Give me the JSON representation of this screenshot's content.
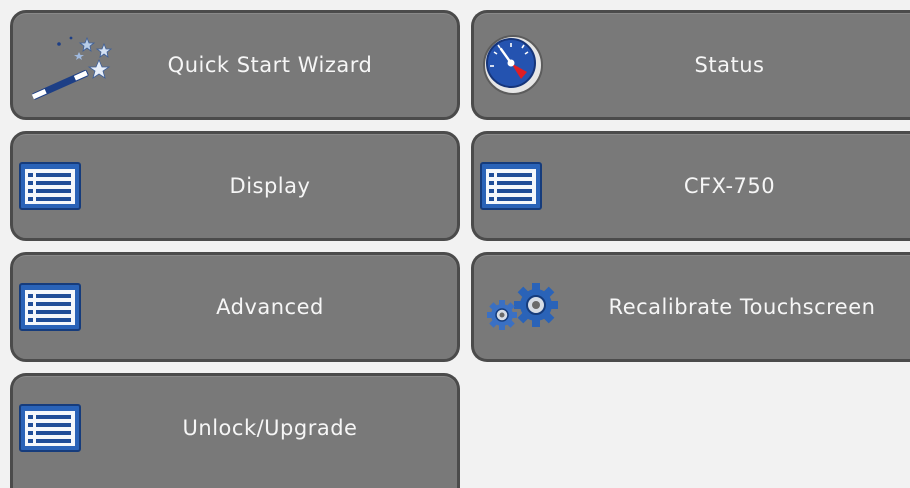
{
  "menu": {
    "items": [
      {
        "label": "Quick Start Wizard",
        "icon": "magic-wand-icon"
      },
      {
        "label": "Status",
        "icon": "gauge-icon"
      },
      {
        "label": "Display",
        "icon": "list-window-icon"
      },
      {
        "label": "CFX-750",
        "icon": "list-window-icon"
      },
      {
        "label": "Advanced",
        "icon": "list-window-icon"
      },
      {
        "label": "Recalibrate Touchscreen",
        "icon": "gears-icon"
      },
      {
        "label": "Unlock/Upgrade",
        "icon": "list-window-icon"
      }
    ]
  },
  "colors": {
    "tile_background": "#797979",
    "tile_border": "#4b4b4b",
    "page_background": "#f2f2f2",
    "label_text": "#f6f6f6",
    "icon_blue": "#2a63b8"
  }
}
